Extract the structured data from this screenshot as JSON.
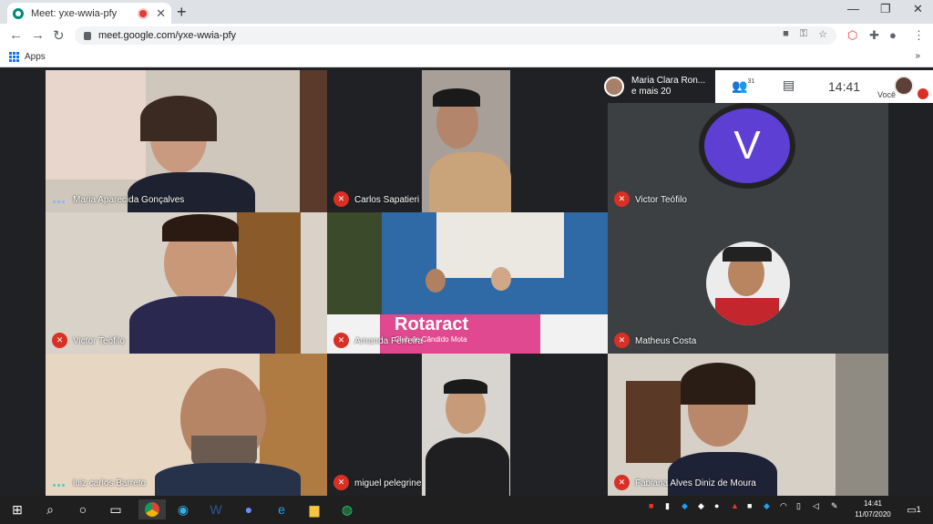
{
  "browser": {
    "tab_title": "Meet: yxe-wwia-pfy",
    "new_tab": "+",
    "close_tab": "✕",
    "url": "meet.google.com/yxe-wwia-pfy",
    "bookmarks_apps": "Apps",
    "minimize": "—",
    "maximize": "❐",
    "close": "✕",
    "back": "←",
    "forward": "→",
    "reload": "↻",
    "bookmarks_more": "»"
  },
  "meet": {
    "attendee_line1": "Maria Clara Ron...",
    "attendee_line2": "e mais 20",
    "people_count": "31",
    "time": "14:41",
    "self_label": "Você",
    "tiles": [
      {
        "name": "Maria Aparecida Gonçalves"
      },
      {
        "name": "Carlos Sapatieri"
      },
      {
        "name": "Victor Teófilo",
        "initial": "V"
      },
      {
        "name": "Victor Teófilo"
      },
      {
        "name": "Amanda Ferreira",
        "banner": "Rotaract",
        "banner_sub": "Club de Cândido Mota"
      },
      {
        "name": "Matheus Costa"
      },
      {
        "name": "luiz carlos Barreto"
      },
      {
        "name": "miguel pelegrine"
      },
      {
        "name": "Fabiana Alves Diniz de Moura"
      }
    ]
  },
  "taskbar": {
    "clock_time": "14:41",
    "clock_date": "11/07/2020",
    "notification_count": "1"
  },
  "colors": {
    "accent": "#5d3fd3",
    "mic_off": "#d93025",
    "background": "#202124"
  }
}
